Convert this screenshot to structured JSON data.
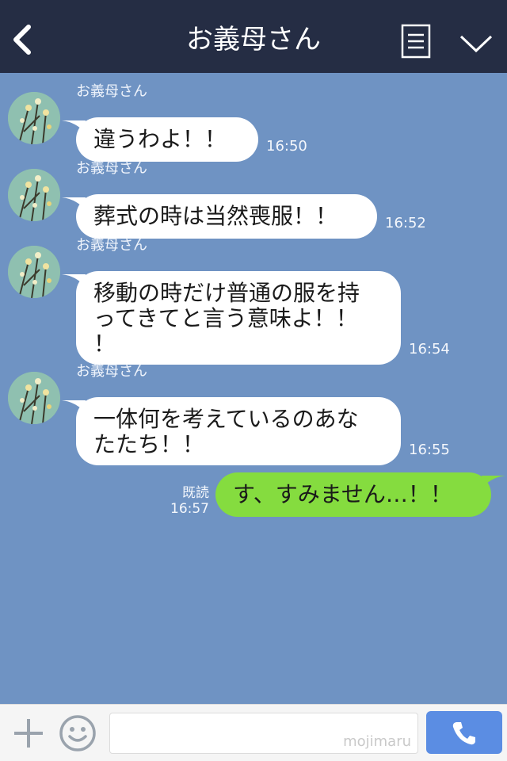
{
  "header": {
    "title": "お義母さん"
  },
  "messages_in": [
    {
      "sender": "お義母さん",
      "text": "違うわよ！！",
      "time": "16:50"
    },
    {
      "sender": "お義母さん",
      "text": "葬式の時は当然喪服！！",
      "time": "16:52"
    },
    {
      "sender": "お義母さん",
      "lines": [
        "移動の時だけ普通の服を持",
        "ってきてと言う意味よ！！",
        "！"
      ],
      "time": "16:54"
    },
    {
      "sender": "お義母さん",
      "lines": [
        "一体何を考えているのあな",
        "たたち！！"
      ],
      "time": "16:55"
    }
  ],
  "message_out": {
    "text": "す、すみません…！！",
    "read_label": "既読",
    "time": "16:57"
  },
  "footer": {
    "input_placeholder": "",
    "watermark": "mojimaru"
  },
  "icons": [
    "back-arrow-icon",
    "menu-list-icon",
    "chevron-down-icon",
    "plus-icon",
    "smile-icon",
    "phone-icon"
  ],
  "colors": {
    "header": "#252d44",
    "background": "#6f93c3",
    "outgoing_bubble": "#85dc3f",
    "call_button": "#5b8de3"
  }
}
